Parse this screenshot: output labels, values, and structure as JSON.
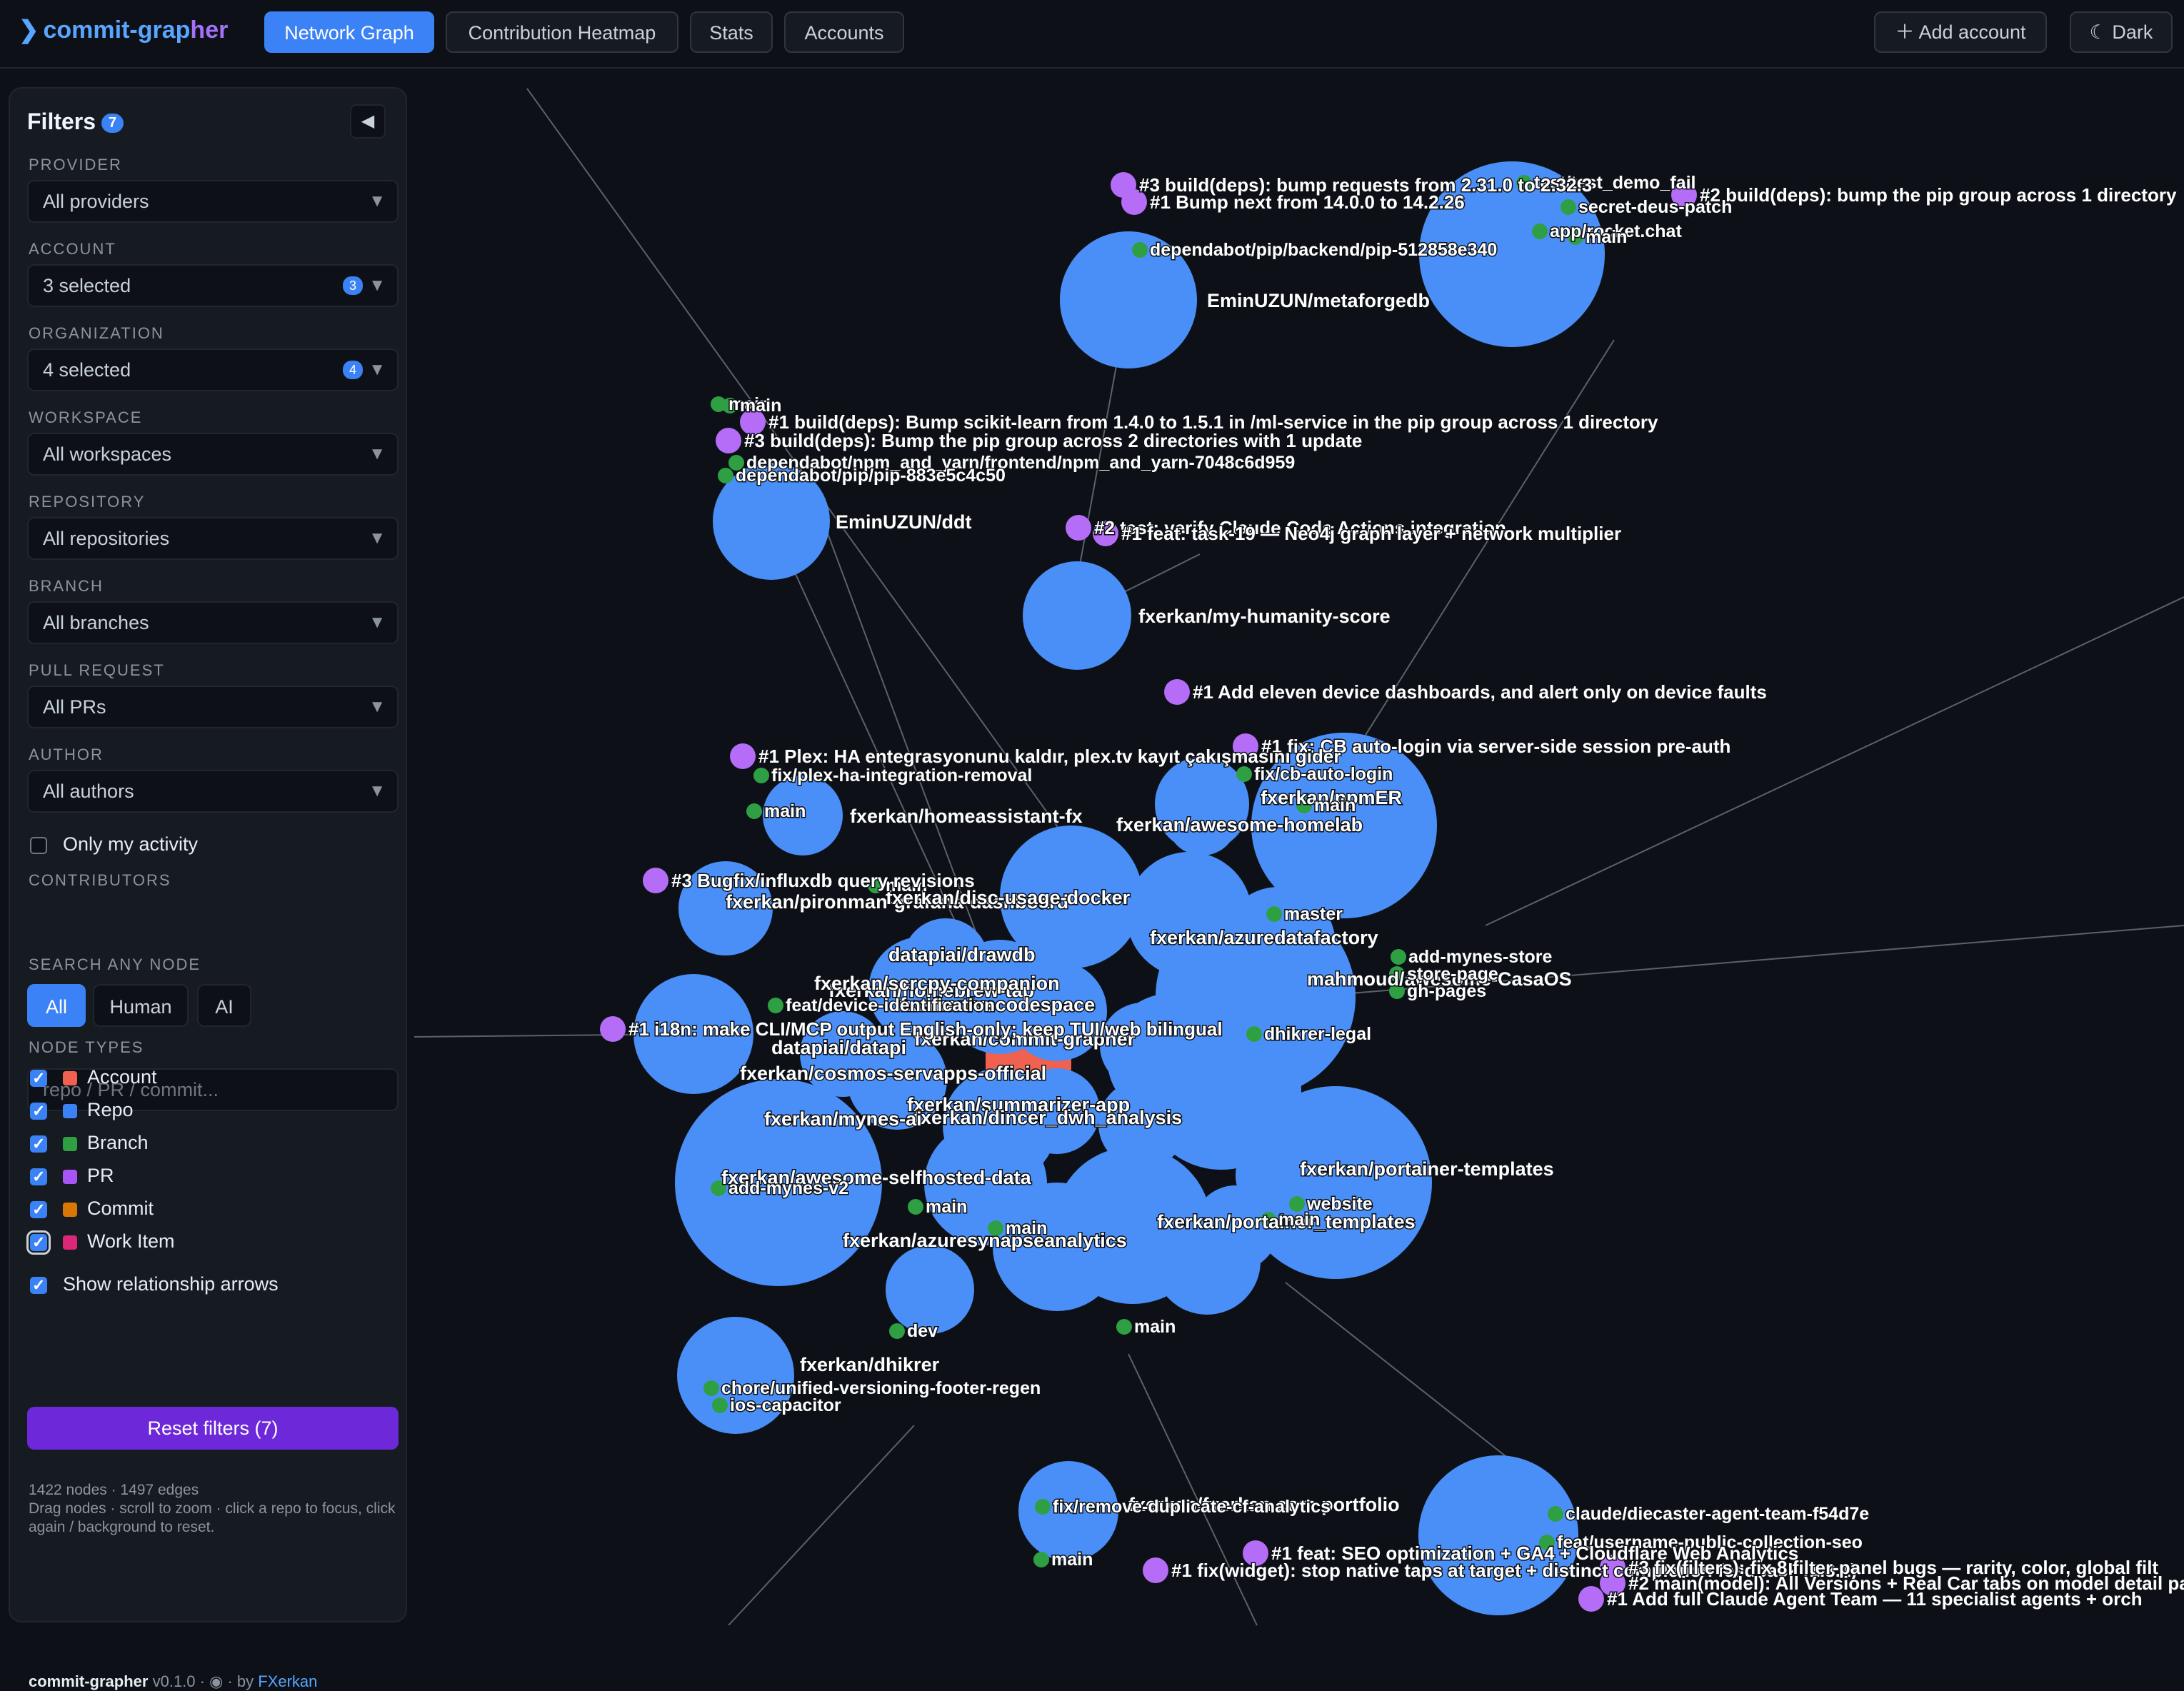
{
  "app": {
    "logo_prefix": "commit-grap",
    "logo_suffix": "her"
  },
  "nav": {
    "tabs": [
      "Network Graph",
      "Contribution Heatmap",
      "Stats",
      "Accounts"
    ],
    "active": "Network Graph"
  },
  "header_actions": {
    "add_account": "Add account",
    "theme": "Dark"
  },
  "filters": {
    "title": "Filters",
    "count": "7",
    "provider": {
      "label": "PROVIDER",
      "value": "All providers"
    },
    "account": {
      "label": "ACCOUNT",
      "value": "3 selected",
      "count": "3"
    },
    "organization": {
      "label": "ORGANIZATION",
      "value": "4 selected",
      "count": "4"
    },
    "workspace": {
      "label": "WORKSPACE",
      "value": "All workspaces"
    },
    "repository": {
      "label": "REPOSITORY",
      "value": "All repositories"
    },
    "branch": {
      "label": "BRANCH",
      "value": "All branches"
    },
    "pull_request": {
      "label": "PULL REQUEST",
      "value": "All PRs"
    },
    "author": {
      "label": "AUTHOR",
      "value": "All authors"
    },
    "only_my_activity": "Only my activity",
    "contributors": {
      "label": "CONTRIBUTORS",
      "options": [
        "All",
        "Human",
        "AI"
      ],
      "selected": "All"
    },
    "search": {
      "label": "SEARCH ANY NODE",
      "placeholder": "repo / PR / commit..."
    },
    "node_types": {
      "label": "NODE TYPES",
      "items": [
        {
          "label": "Account",
          "color": "#f0614f",
          "checked": true
        },
        {
          "label": "Repo",
          "color": "#3b82f6",
          "checked": true
        },
        {
          "label": "Branch",
          "color": "#2ea043",
          "checked": true
        },
        {
          "label": "PR",
          "color": "#a855f7",
          "checked": true
        },
        {
          "label": "Commit",
          "color": "#d97706",
          "checked": true
        },
        {
          "label": "Work Item",
          "color": "#db2777",
          "checked": true
        }
      ]
    },
    "show_arrows": "Show relationship arrows",
    "reset": "Reset filters (7)"
  },
  "graph_stats": {
    "summary": "1422 nodes · 1497 edges",
    "hint": "Drag nodes · scroll to zoom · click a repo to focus, click again / background to reset."
  },
  "footer": {
    "name": "commit-grapher",
    "version": "v0.1.0",
    "by": "by",
    "author": "FXerkan"
  },
  "colors": {
    "repo": "#4a8ff7",
    "branch": "#2ea043",
    "pr": "#b56cf7",
    "account": "#f0614f",
    "edge": "#5a616b"
  },
  "graph": {
    "repos": [
      {
        "label": "EminUZUN/metaforgedb"
      },
      {
        "label": "EminUZUN/ddt"
      },
      {
        "label": "fxerkan/my-humanity-score"
      },
      {
        "label": "fxerkan/homeassistant-fx"
      },
      {
        "label": "fxerkan/ppmER"
      },
      {
        "label": "fxerkan/awesome-homelab"
      },
      {
        "label": "fxerkan/pironman-grafana-dashboard"
      },
      {
        "label": "fxerkan/disc-usage-docker"
      },
      {
        "label": "fxerkan/azuredatafactory"
      },
      {
        "label": "datapiai/drawdb"
      },
      {
        "label": "fxerkan/homebrew-tap"
      },
      {
        "label": "fxerkan/scrcpy-companion"
      },
      {
        "label": "fxerkan/vscodespace"
      },
      {
        "label": "fxerkan/commit-grapher"
      },
      {
        "label": "datapiai/datapi"
      },
      {
        "label": "fxerkan/cosmos-servapps-official"
      },
      {
        "label": "fxerkan/summarizer-app"
      },
      {
        "label": "fxerkan/dincer_dwh_analysis"
      },
      {
        "label": "fxerkan/mynes-ai"
      },
      {
        "label": "fxerkan/portainer-templates"
      },
      {
        "label": "fxerkan/portainer_templates"
      },
      {
        "label": "fxerkan/azuresynapseanalytics"
      },
      {
        "label": "fxerkan/dhikrer"
      },
      {
        "label": "fxerkan/fxerkan.com.portfolio"
      },
      {
        "label": "fxerkan/awesome-selfhosted-data"
      },
      {
        "label": "mahmoud/awesome-CasaOS"
      }
    ],
    "branches": [
      "main",
      "dependabot/pip/backend/pip-512858e340",
      "dependabot/npm_and_yarn/frontend/npm_and_yarn-7048c6d959",
      "dependabot/pip/pip-883e5c4c50",
      "fix/plex-ha-integration-removal",
      "fix/cb-auto-login",
      "feat/device-identification",
      "master",
      "add-mynes-store",
      "store-page",
      "gh-pages",
      "dhikrer-legal",
      "add-mynes-v2",
      "website",
      "chore/unified-versioning-footer-regen",
      "ios-capacitor",
      "fix/remove-duplicate-cf-analytics",
      "claude/diecaster-agent-team-f54d7e",
      "feat/username-public-collection-seo",
      "app/rocket.chat",
      "secret-deus-patch",
      "test/test_demo_fail",
      "dev"
    ],
    "prs": [
      "#3 build(deps): bump requests from 2.31.0 to 2.32.3",
      "#1 Bump next from 14.0.0 to 14.2.26",
      "#2 build(deps): bump the pip group across 1 directory",
      "#1 build(deps): Bump scikit-learn from 1.4.0 to 1.5.1 in /ml-service in the pip group across 1 directory",
      "#3 build(deps): Bump the pip group across 2 directories with 1 update",
      "#2 test: verify Claude Code Actions integration",
      "#1 feat: task-19 — Neo4j graph layer + network multiplier",
      "#1 Add eleven device dashboards, and alert only on device faults",
      "#1 fix: CB auto-login via server-side session pre-auth",
      "#1 Plex: HA entegrasyonunu kaldır, plex.tv kayıt çakışmasını gider",
      "#3 Bugfix/influxdb query revisions",
      "#1 i18n: make CLI/MCP output English-only; keep TUI/web bilingual",
      "#1 fix(widget): stop native taps at target + distinct completion feedback (1.3.1)",
      "#1 feat: SEO optimization + GA4 + Cloudflare Web Analytics",
      "#3 fix(filters): fix 8 filter-panel bugs — rarity, color, global filt",
      "#2 main(model): All Versions + Real Car tabs on model detail pa",
      "#1 Add full Claude Agent Team — 11 specialist agents + orch"
    ]
  }
}
